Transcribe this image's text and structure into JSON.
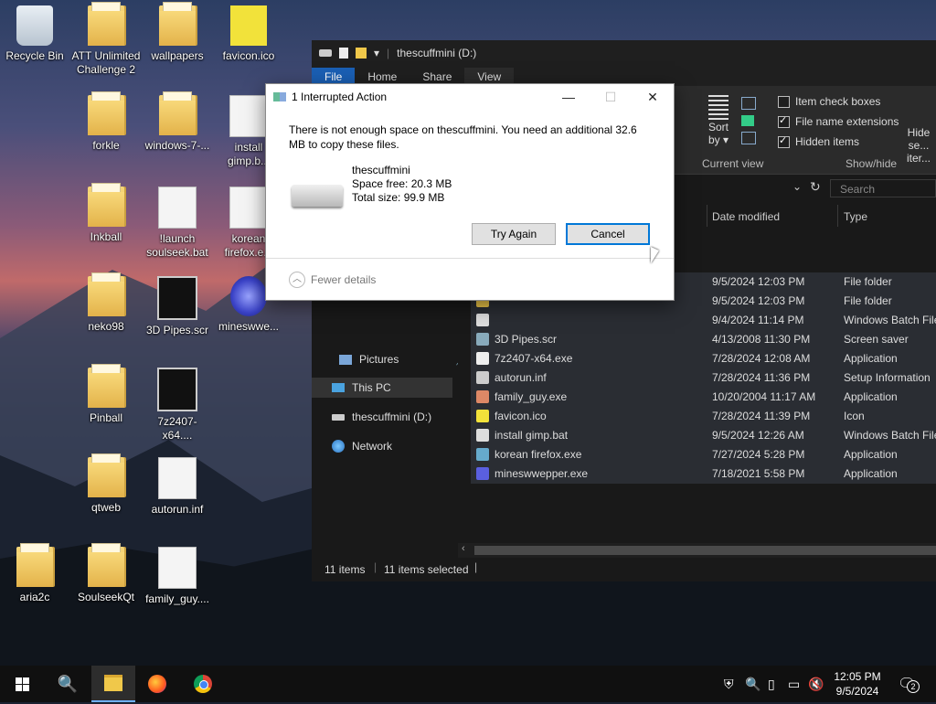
{
  "desktop": {
    "icons": [
      {
        "label": "Recycle Bin",
        "icon": "recycle-bin-icon"
      },
      {
        "label": "ATT Unlimited Challenge 2",
        "icon": "folder-icon"
      },
      {
        "label": "wallpapers",
        "icon": "folder-icon"
      },
      {
        "label": "favicon.ico",
        "icon": "dog-face-icon"
      },
      {
        "label": "forkle",
        "icon": "folder-icon"
      },
      {
        "label": "windows-7-...",
        "icon": "folder-icon"
      },
      {
        "label": "install gimp.b...",
        "icon": "batch-file-icon"
      },
      {
        "label": "Inkball",
        "icon": "folder-icon"
      },
      {
        "label": "!launch soulseek.bat",
        "icon": "batch-file-icon"
      },
      {
        "label": "korean firefox.e...",
        "icon": "installer-icon"
      },
      {
        "label": "neko98",
        "icon": "folder-icon"
      },
      {
        "label": "3D Pipes.scr",
        "icon": "screensaver-icon"
      },
      {
        "label": "mineswwe...",
        "icon": "mine-icon"
      },
      {
        "label": "Pinball",
        "icon": "folder-icon"
      },
      {
        "label": "7z2407-x64....",
        "icon": "7zip-icon"
      },
      {
        "label": "qtweb",
        "icon": "folder-icon"
      },
      {
        "label": "autorun.inf",
        "icon": "settings-file-icon"
      },
      {
        "label": "aria2c",
        "icon": "folder-icon"
      },
      {
        "label": "SoulseekQt",
        "icon": "folder-icon"
      },
      {
        "label": "family_guy....",
        "icon": "family-guy-icon"
      }
    ]
  },
  "explorer": {
    "title": "thescuffmini (D:)",
    "tabs": [
      "File",
      "Home",
      "Share",
      "View"
    ],
    "ribbon": {
      "sort_label": "Sort",
      "by_label": "by",
      "current_view": "Current view",
      "show_hide": "Show/hide",
      "item_check_boxes": "Item check boxes",
      "file_name_extensions": "File name extensions",
      "hidden_items": "Hidden items",
      "hide_selected": "Hide se...",
      "hide_selected_2": "iter...",
      "checks": {
        "item_check_boxes": false,
        "file_name_extensions": true,
        "hidden_items": true
      }
    },
    "search_placeholder": "Search thescuffmini",
    "nav": {
      "pictures": "Pictures",
      "this_pc": "This PC",
      "drive": "thescuffmini (D:)",
      "network": "Network"
    },
    "columns": {
      "date_modified": "Date modified",
      "type": "Type"
    },
    "files": [
      {
        "name": "",
        "date": "9/5/2024 12:03 PM",
        "type": "File folder"
      },
      {
        "name": "",
        "date": "9/5/2024 12:03 PM",
        "type": "File folder"
      },
      {
        "name": "",
        "date": "9/4/2024 11:14 PM",
        "type": "Windows Batch File"
      },
      {
        "name": "3D Pipes.scr",
        "date": "4/13/2008 11:30 PM",
        "type": "Screen saver"
      },
      {
        "name": "7z2407-x64.exe",
        "date": "7/28/2024 12:08 AM",
        "type": "Application"
      },
      {
        "name": "autorun.inf",
        "date": "7/28/2024 11:36 PM",
        "type": "Setup Information"
      },
      {
        "name": "family_guy.exe",
        "date": "10/20/2004 11:17 AM",
        "type": "Application"
      },
      {
        "name": "favicon.ico",
        "date": "7/28/2024 11:39 PM",
        "type": "Icon"
      },
      {
        "name": "install gimp.bat",
        "date": "9/5/2024 12:26 AM",
        "type": "Windows Batch File"
      },
      {
        "name": "korean firefox.exe",
        "date": "7/27/2024 5:28 PM",
        "type": "Application"
      },
      {
        "name": "mineswwepper.exe",
        "date": "7/18/2021 5:58 PM",
        "type": "Application"
      }
    ],
    "status": {
      "items": "11 items",
      "selected": "11 items selected"
    }
  },
  "dialog": {
    "title": "1 Interrupted Action",
    "message": "There is not enough space on thescuffmini. You need an additional 32.6 MB to copy these files.",
    "drive_name": "thescuffmini",
    "space_free": "Space free: 20.3 MB",
    "total_size": "Total size: 99.9 MB",
    "try_again": "Try Again",
    "cancel": "Cancel",
    "fewer_details": "Fewer details"
  },
  "taskbar": {
    "time": "12:05 PM",
    "date": "9/5/2024",
    "notification_count": "2"
  },
  "colors": {
    "accent": "#0078d7",
    "file_tab": "#1a5fb4"
  }
}
